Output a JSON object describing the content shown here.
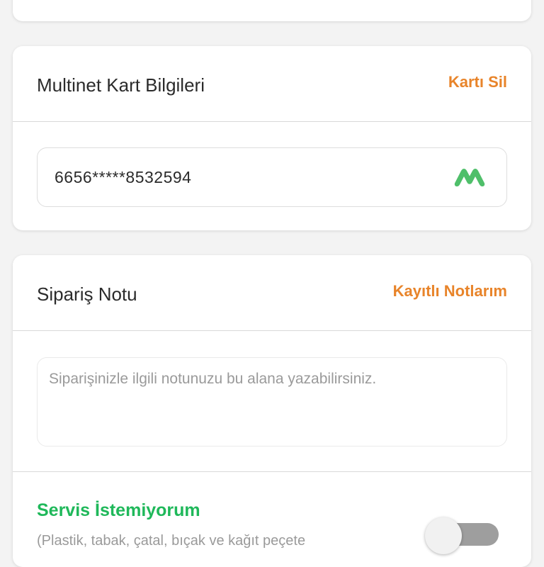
{
  "multinet_card": {
    "title": "Multinet Kart Bilgileri",
    "action_label": "Kartı Sil",
    "card_number": "6656*****8532594",
    "logo_icon": "multinet-m-logo",
    "accent_color": "#e8842a",
    "logo_color": "#4fbf6a"
  },
  "order_note": {
    "title": "Sipariş Notu",
    "action_label": "Kayıtlı Notlarım",
    "placeholder": "Siparişinizle ilgili notunuzu bu alana yazabilirsiniz.",
    "value": ""
  },
  "service_option": {
    "title": "Servis İstemiyorum",
    "subtitle": "(Plastik, tabak, çatal, bıçak ve kağıt peçete",
    "title_color": "#1fb85a",
    "toggle_on": false
  }
}
